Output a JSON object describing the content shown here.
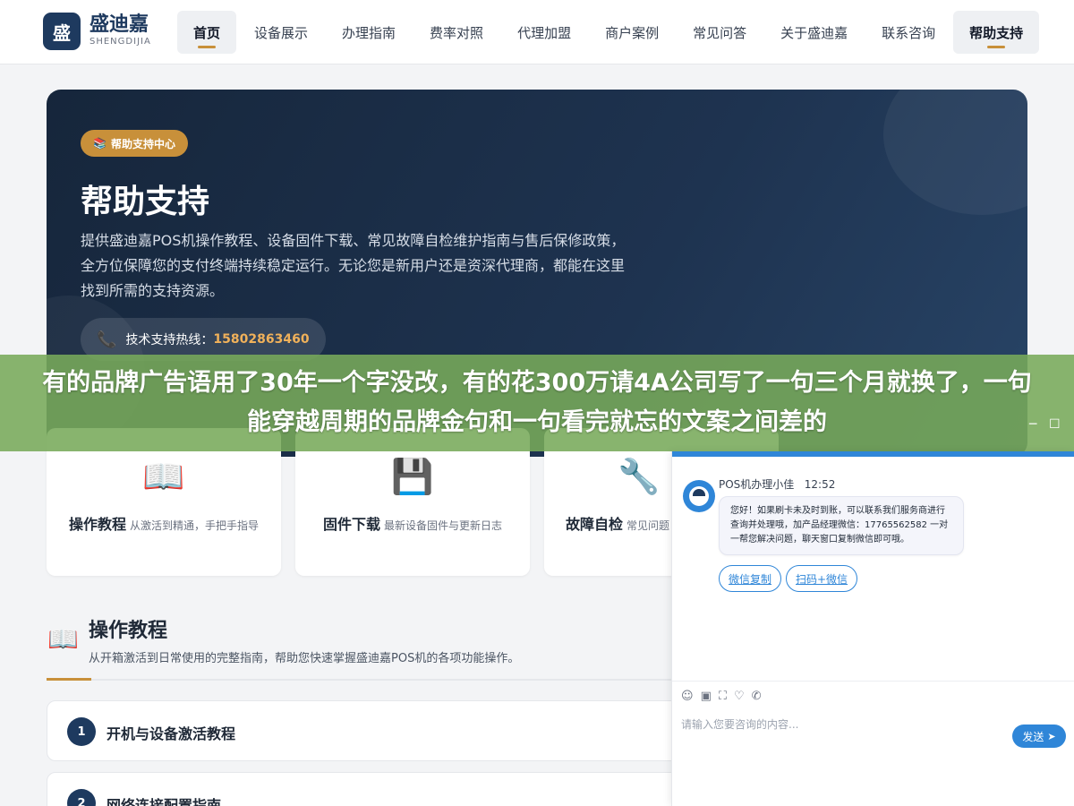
{
  "brand": {
    "logo_char": "盛",
    "name": "盛迪嘉",
    "name_en": "SHENGDIJIA"
  },
  "nav": [
    {
      "label": "首页",
      "active": true
    },
    {
      "label": "设备展示",
      "active": false
    },
    {
      "label": "办理指南",
      "active": false
    },
    {
      "label": "费率对照",
      "active": false
    },
    {
      "label": "代理加盟",
      "active": false
    },
    {
      "label": "商户案例",
      "active": false
    },
    {
      "label": "常见问答",
      "active": false
    },
    {
      "label": "关于盛迪嘉",
      "active": false
    },
    {
      "label": "联系咨询",
      "active": false
    },
    {
      "label": "帮助支持",
      "active": true
    }
  ],
  "hero": {
    "badge": "帮助支持中心",
    "title": "帮助支持",
    "desc": "提供盛迪嘉POS机操作教程、设备固件下载、常见故障自检维护指南与售后保修政策，全方位保障您的支付终端持续稳定运行。无论您是新用户还是资深代理商，都能在这里找到所需的支持资源。",
    "hotline_label": "技术支持热线：",
    "hotline_number": "15802863460"
  },
  "banner": {
    "text": "有的品牌广告语用了30年一个字没改，有的花300万请4A公司写了一句三个月就换了，一句能穿越周期的品牌金句和一句看完就忘的文案之间差的"
  },
  "cards": [
    {
      "icon": "book-icon",
      "title": "操作教程",
      "desc": "从激活到精通，手把手指导"
    },
    {
      "icon": "floppy-disk-icon",
      "title": "固件下载",
      "desc": "最新设备固件与更新日志"
    },
    {
      "icon": "wrench-icon",
      "title": "故障自检",
      "desc": "常见问题"
    }
  ],
  "section": {
    "title": "操作教程",
    "subtitle": "从开箱激活到日常使用的完整指南，帮助您快速掌握盛迪嘉POS机的各项功能操作。",
    "items": [
      {
        "num": "1",
        "title": "开机与设备激活教程"
      },
      {
        "num": "2",
        "title": "网络连接配置指南"
      }
    ]
  },
  "chat": {
    "agent_name": "POS机办理小佳",
    "time": "12:52",
    "message": "您好！如果刷卡未及时到账，可以联系我们服务商进行查询并处理哦，加产品经理微信：17765562582 一对一帮您解决问题，聊天窗口复制微信即可哦。",
    "quick_replies": [
      "微信复制",
      "扫码+微信"
    ],
    "input_placeholder": "请输入您要咨询的内容...",
    "send_label": "发送"
  },
  "colors": {
    "accent": "#c8903a",
    "navy": "#1e3a5f",
    "chat_blue": "#2f86d8",
    "banner": "#78aa5a"
  }
}
